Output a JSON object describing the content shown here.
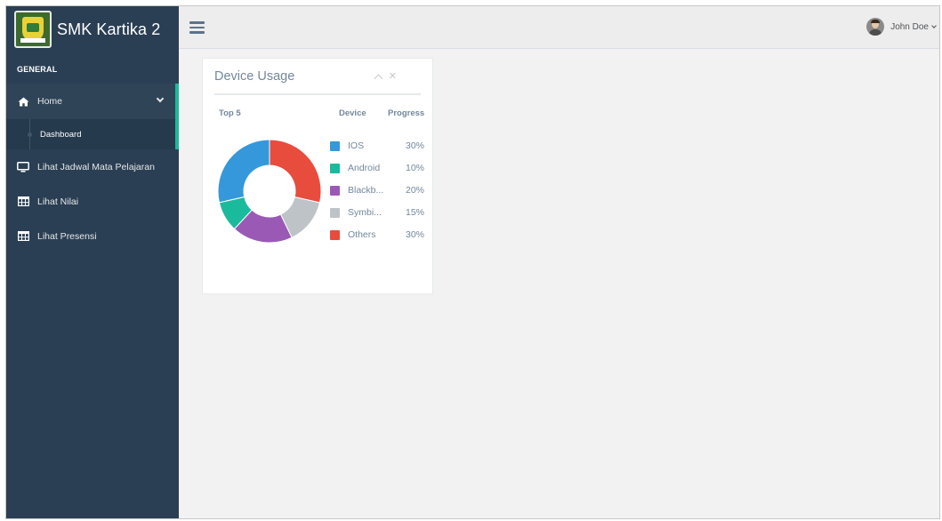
{
  "app": {
    "brand_name": "SMK Kartika 2"
  },
  "sidebar": {
    "section_title": "GENERAL",
    "items": [
      {
        "label": "Home",
        "icon": "home-icon"
      },
      {
        "label": "Dashboard",
        "icon": "dot-icon"
      },
      {
        "label": "Lihat Jadwal Mata Pelajaran",
        "icon": "monitor-icon"
      },
      {
        "label": "Lihat Nilai",
        "icon": "table-icon"
      },
      {
        "label": "Lihat Presensi",
        "icon": "table-icon"
      }
    ]
  },
  "topbar": {
    "user_name": "John Doe"
  },
  "panel": {
    "title": "Device Usage",
    "headers": {
      "top": "Top 5",
      "device": "Device",
      "progress": "Progress"
    }
  },
  "colors": {
    "sidebar_bg": "#2a3f54",
    "accent": "#1abb9c",
    "text_muted": "#73879c"
  },
  "chart_data": {
    "type": "pie",
    "categories": [
      "IOS",
      "Android",
      "Blackb...",
      "Symbi...",
      "Others"
    ],
    "labels": [
      "30%",
      "10%",
      "20%",
      "15%",
      "30%"
    ],
    "values": [
      30,
      10,
      20,
      15,
      30
    ],
    "colors": [
      "#3498db",
      "#1abb9c",
      "#9b59b6",
      "#bdc3c7",
      "#e74c3c"
    ],
    "hole": 0.5
  }
}
